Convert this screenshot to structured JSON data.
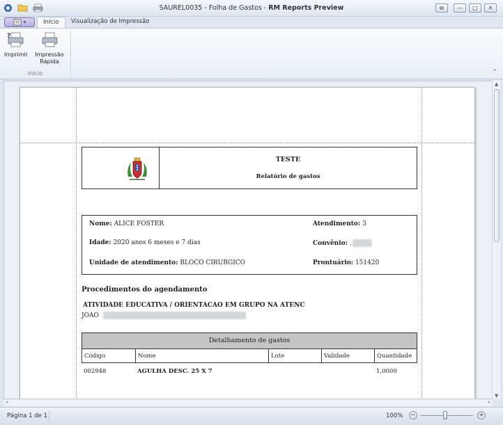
{
  "window": {
    "title_prefix": "SAUREL0035 - Folha de Gastos - ",
    "title_app": "RM Reports Preview"
  },
  "tabs": [
    {
      "label": "Início",
      "active": true
    },
    {
      "label": "Visualização de Impressão",
      "active": false
    }
  ],
  "ribbon": {
    "print_label": "Imprimir",
    "quick_print_label_1": "Impressão",
    "quick_print_label_2": "Rápida",
    "group_label": "Início"
  },
  "report": {
    "title": "TESTE",
    "subtitle": "Relatório de gastos",
    "patient": {
      "name_label": "Nome:",
      "name_value": "ALICE FOSTER",
      "age_label": "Idade:",
      "age_value": "2020 anos 6 meses  e 7 dias",
      "unit_label": "Unidade de atendimento:",
      "unit_value": "BLOCO CIRURGICO",
      "attendance_label": "Atendimento:",
      "attendance_value": "3",
      "insurance_label": "Convênio:",
      "insurance_value": ".",
      "record_label": "Prontuário:",
      "record_value": "151420"
    },
    "procedures_title": "Procedimentos do agendamento",
    "procedure_name": "ATIVIDADE EDUCATIVA / ORIENTACAO EM GRUPO NA ATENC",
    "professional_name": "JOAO",
    "expenses": {
      "title": "Detalhamento de gastos",
      "columns": [
        "Código",
        "Nome",
        "Lote",
        "Validade",
        "Quantidade"
      ],
      "rows": [
        {
          "code": "002948",
          "name": "AGULHA DESC. 25 X 7",
          "lot": "",
          "validity": "",
          "quantity": "1,0000"
        }
      ]
    }
  },
  "status": {
    "page_info": "Página 1 de 1",
    "zoom": "100%",
    "zoom_level_percent": 100
  },
  "colors": {
    "ribbon_bg": "#e9eef5",
    "table_header_bg": "#c5c5c5",
    "file_button": "#b8aee3"
  }
}
